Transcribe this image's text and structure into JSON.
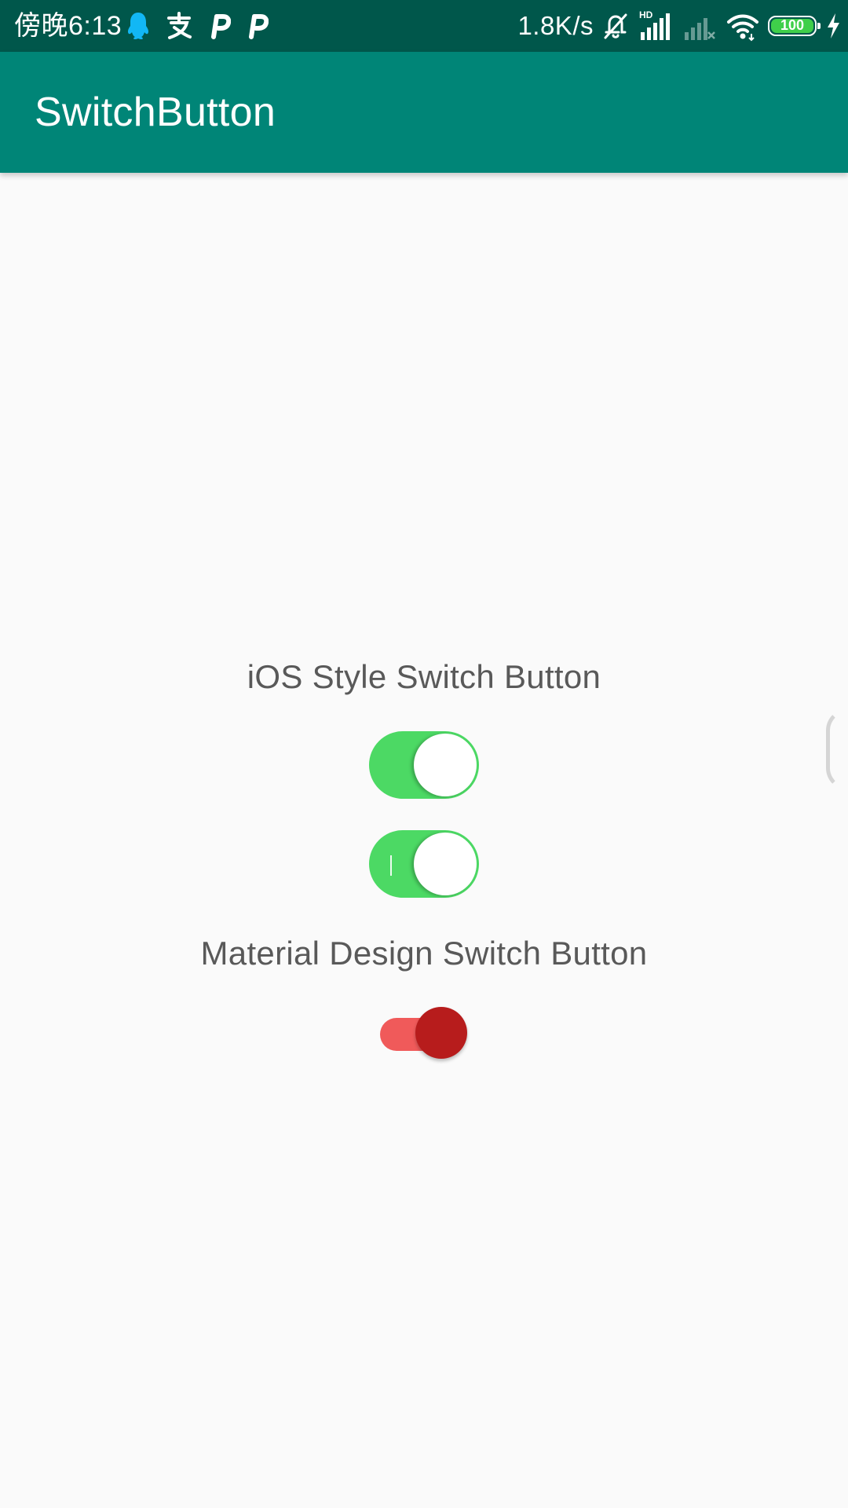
{
  "status_bar": {
    "time": "傍晚6:13",
    "left_icons": [
      "qq-icon",
      "alipay-icon",
      "p-icon",
      "p-icon"
    ],
    "network_speed": "1.8K/s",
    "hd_label": "HD",
    "battery_level": "100",
    "right_icons": [
      "mute-bell-icon",
      "signal-hd-icon",
      "signal-weak-icon",
      "wifi-icon",
      "battery-icon",
      "charging-icon"
    ]
  },
  "app_bar": {
    "title": "SwitchButton"
  },
  "content": {
    "ios_label": "iOS Style Switch Button",
    "md_label": "Material Design Switch Button",
    "switches": [
      {
        "style": "ios",
        "checked": true
      },
      {
        "style": "ios",
        "checked": true
      },
      {
        "style": "material",
        "checked": true
      }
    ]
  },
  "colors": {
    "status_bar": "#00574b",
    "app_bar": "#008577",
    "background": "#fafafa",
    "ios_on": "#4cd964",
    "md_track": "#f05a5a",
    "md_thumb": "#b71c1c",
    "label_text": "#595959"
  }
}
